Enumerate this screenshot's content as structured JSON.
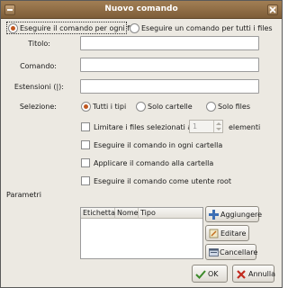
{
  "window": {
    "title": "Nuovo comando"
  },
  "mode": {
    "option_each_file": "Eseguire il comando per ogni file",
    "option_all_files": "Eseguire un comando per tutti i files",
    "selected": "each_file"
  },
  "form": {
    "title_label": "Titolo:",
    "command_label": "Comando:",
    "extensions_label": "Estensioni (|):",
    "title_value": "",
    "command_value": "",
    "extensions_value": ""
  },
  "selection": {
    "label": "Selezione:",
    "options": [
      "Tutti i tipi",
      "Solo cartelle",
      "Solo files"
    ],
    "selected": "Tutti i tipi"
  },
  "options": {
    "limit_label": "Limitare i files selezionati a",
    "limit_value": "1",
    "limit_suffix": "elementi",
    "each_folder": "Eseguire il comando in ogni cartella",
    "apply_folder": "Applicare il comando alla cartella",
    "as_root": "Eseguire il comando come utente root"
  },
  "params": {
    "section_label": "Parametri",
    "columns": [
      "Etichetta",
      "Nome",
      "Tipo"
    ],
    "rows": [],
    "add_button": "Aggiungere",
    "edit_button": "Editare",
    "delete_button": "Cancellare"
  },
  "footer": {
    "ok_button": "OK",
    "cancel_button": "Annulla"
  },
  "colors": {
    "titlebar": "#8f6d45",
    "radio_selected": "#c0571f",
    "window_bg": "#ece9e2"
  },
  "icons": {
    "add": "plus-icon",
    "edit": "edit-icon",
    "delete": "delete-icon",
    "ok": "check-icon",
    "cancel": "cancel-icon"
  }
}
